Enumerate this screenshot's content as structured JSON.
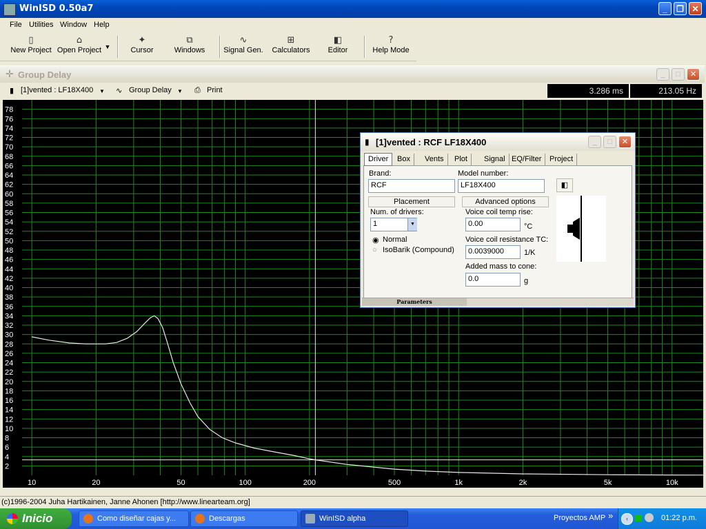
{
  "app": {
    "title": "WinISD 0.50a7"
  },
  "menu": [
    "File",
    "Utilities",
    "Window",
    "Help"
  ],
  "toolbar": {
    "new_project": "New Project",
    "open_project": "Open Project",
    "cursor": "Cursor",
    "windows": "Windows",
    "signal_gen": "Signal Gen.",
    "calculators": "Calculators",
    "editor": "Editor",
    "help_mode": "Help Mode"
  },
  "graph_window": {
    "title": "Group Delay",
    "project_select": "[1]vented : LF18X400",
    "graph_type": "Group Delay",
    "print": "Print",
    "readout_time": "3.286 ms",
    "readout_freq": "213.05 Hz"
  },
  "chart_data": {
    "type": "line",
    "title": "",
    "xlabel": "",
    "ylabel": "",
    "x_scale": "log",
    "xlim": [
      9,
      14000
    ],
    "ylim": [
      0,
      80
    ],
    "grid": true,
    "x_tick_labels": [
      "10",
      "20",
      "50",
      "100",
      "200",
      "500",
      "1k",
      "2k",
      "5k",
      "10k"
    ],
    "y_tick_labels": [
      "2",
      "4",
      "6",
      "8",
      "10",
      "12",
      "14",
      "16",
      "18",
      "20",
      "22",
      "24",
      "26",
      "28",
      "30",
      "32",
      "34",
      "36",
      "38",
      "40",
      "42",
      "44",
      "46",
      "48",
      "50",
      "52",
      "54",
      "56",
      "58",
      "60",
      "62",
      "64",
      "66",
      "68",
      "70",
      "72",
      "74",
      "76",
      "78"
    ],
    "cursor": {
      "x": 213.05,
      "y": 3.286
    },
    "series": [
      {
        "color": "#e8e8e8",
        "points": [
          [
            10,
            29.5
          ],
          [
            12,
            28.8
          ],
          [
            15,
            28.2
          ],
          [
            18,
            28.0
          ],
          [
            22,
            28.0
          ],
          [
            25,
            28.3
          ],
          [
            28,
            29.2
          ],
          [
            31,
            30.6
          ],
          [
            34,
            32.5
          ],
          [
            36,
            33.6
          ],
          [
            37.5,
            34.0
          ],
          [
            39,
            33.4
          ],
          [
            41,
            31.5
          ],
          [
            43,
            28.5
          ],
          [
            46,
            24.0
          ],
          [
            50,
            19.5
          ],
          [
            55,
            15.5
          ],
          [
            60,
            12.5
          ],
          [
            68,
            9.8
          ],
          [
            78,
            8.0
          ],
          [
            90,
            6.9
          ],
          [
            110,
            5.8
          ],
          [
            140,
            4.9
          ],
          [
            170,
            4.2
          ],
          [
            200,
            3.5
          ],
          [
            213.05,
            3.286
          ],
          [
            300,
            2.3
          ],
          [
            500,
            1.3
          ],
          [
            700,
            0.9
          ],
          [
            1000,
            0.6
          ],
          [
            2000,
            0.3
          ],
          [
            5000,
            0.12
          ],
          [
            10000,
            0.06
          ],
          [
            14000,
            0.04
          ]
        ]
      }
    ]
  },
  "dialog": {
    "title": "[1]vented : RCF LF18X400",
    "tabs": [
      "Driver",
      "Box",
      "Vents",
      "Plot",
      "Signal",
      "EQ/Filter",
      "Project"
    ],
    "brand_label": "Brand:",
    "brand_value": "RCF",
    "model_label": "Model number:",
    "model_value": "LF18X400",
    "placement_button": "Placement",
    "advanced_button": "Advanced options",
    "num_drivers_label": "Num. of drivers:",
    "num_drivers_value": "1",
    "radio_normal": "Normal",
    "radio_isobarik": "IsoBarik (Compound)",
    "vc_temp_label": "Voice coil temp rise:",
    "vc_temp_value": "0.00",
    "vc_temp_unit": "°C",
    "vc_res_label": "Voice coil resistance TC:",
    "vc_res_value": "0.0039000",
    "vc_res_unit": "1/K",
    "mass_label": "Added mass to cone:",
    "mass_value": "0.0",
    "mass_unit": "g",
    "parameters_tab": "Parameters"
  },
  "status": {
    "text": "(c)1996-2004 Juha Hartikainen, Janne Ahonen [http://www.linearteam.org]"
  },
  "taskbar": {
    "start": "Inicio",
    "tasks": [
      "Como diseñar cajas y...",
      "Descargas",
      "WinISD alpha"
    ],
    "toolbar_label": "Proyectos AMP",
    "chevron": "»",
    "time": "01:22 p.m."
  }
}
